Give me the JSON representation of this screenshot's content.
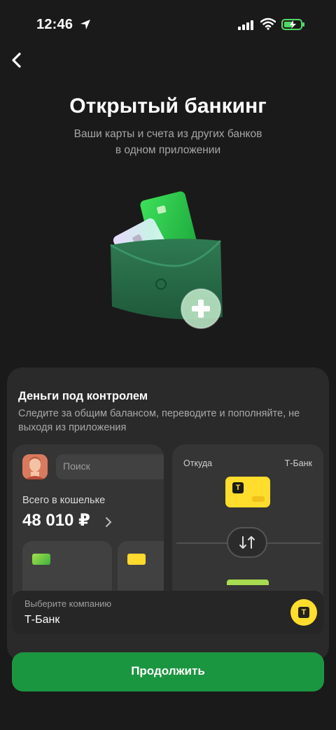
{
  "status_bar": {
    "time": "12:46"
  },
  "header": {
    "title": "Открытый банкинг",
    "subtitle_line1": "Ваши карты и счета из других банков",
    "subtitle_line2": "в одном приложении"
  },
  "feature_panel": {
    "title": "Деньги под контролем",
    "description": "Следите за общим балансом, переводите и пополняйте, не выходя из приложения",
    "wallet_preview": {
      "search_placeholder": "Поиск",
      "total_label": "Всего в кошельке",
      "total_amount": "48 010 ₽"
    },
    "transfer_preview": {
      "from_label": "Откуда",
      "from_bank": "Т-Банк",
      "bank_logo_text": "T"
    }
  },
  "company_select": {
    "label": "Выберите компанию",
    "value": "Т-Банк",
    "logo_text": "T"
  },
  "continue_button": {
    "label": "Продолжить"
  },
  "colors": {
    "accent": "#1b9640",
    "tbank_yellow": "#ffdd2d",
    "background": "#1a1a1a"
  }
}
